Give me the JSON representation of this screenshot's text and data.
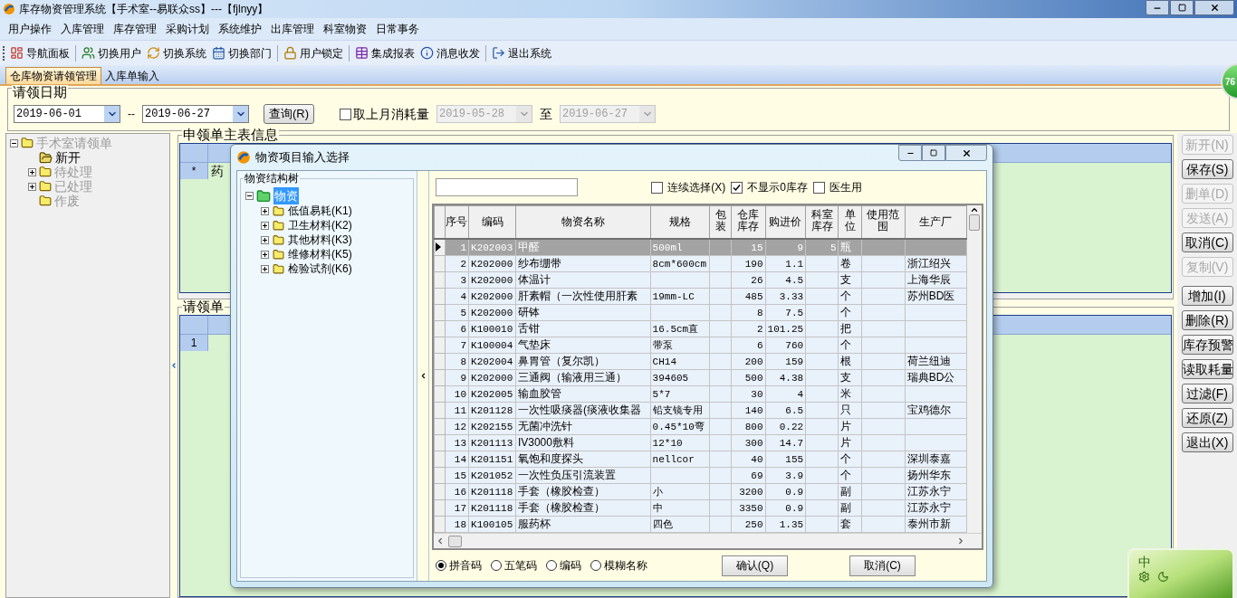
{
  "window": {
    "title": "库存物资管理系统【手术室--易联众ss】---【fjlnyy】"
  },
  "menu": [
    "用户操作",
    "入库管理",
    "库存管理",
    "采购计划",
    "系统维护",
    "出库管理",
    "科室物资",
    "日常事务"
  ],
  "toolbar": [
    {
      "label": "导航面板",
      "separator_after": true
    },
    {
      "label": "切换用户",
      "separator_after": false
    },
    {
      "label": "切换系统",
      "separator_after": false
    },
    {
      "label": "切换部门",
      "separator_after": true
    },
    {
      "label": "用户锁定",
      "separator_after": true
    },
    {
      "label": "集成报表",
      "separator_after": false
    },
    {
      "label": "消息收发",
      "separator_after": true
    },
    {
      "label": "退出系统",
      "separator_after": false
    }
  ],
  "tabs": [
    {
      "label": "仓库物资请领管理",
      "selected": true
    },
    {
      "label": "入库单输入",
      "selected": false
    }
  ],
  "date_group": {
    "title": "请领日期",
    "from": "2019-06-01",
    "dash": "--",
    "to": "2019-06-27",
    "query_button": "查询(R)",
    "last_month": {
      "label": "取上月消耗量",
      "checked": false
    },
    "range_from": "2019-05-28",
    "range_sep": "至",
    "range_to": "2019-06-27",
    "range_disabled": true
  },
  "tree": {
    "label": "手术室请领单",
    "expanded": true,
    "selected": false,
    "children": [
      {
        "label": "新开",
        "selected": true,
        "expandable": false
      },
      {
        "label": "待处理",
        "selected": false,
        "expandable": true
      },
      {
        "label": "已处理",
        "selected": false,
        "expandable": true
      },
      {
        "label": "作废",
        "selected": false,
        "expandable": false
      }
    ]
  },
  "master": {
    "title": "申领单主表信息",
    "rows": [
      {
        "marker": "*",
        "cell": "药"
      }
    ]
  },
  "detail": {
    "title": "请领单",
    "rows": [
      {
        "marker": "1"
      }
    ]
  },
  "side_buttons": [
    {
      "label": "新开(N)",
      "disabled": true
    },
    {
      "label": "保存(S)",
      "disabled": false
    },
    {
      "label": "删单(D)",
      "disabled": true
    },
    {
      "label": "发送(A)",
      "disabled": true
    },
    {
      "label": "取消(C)",
      "disabled": false
    },
    {
      "label": "复制(V)",
      "disabled": true
    },
    {
      "label": "增加(I)",
      "disabled": false
    },
    {
      "label": "删除(R)",
      "disabled": false
    },
    {
      "label": "库存预警",
      "disabled": false
    },
    {
      "label": "读取耗量",
      "disabled": false
    },
    {
      "label": "过滤(F)",
      "disabled": false
    },
    {
      "label": "还原(Z)",
      "disabled": false
    },
    {
      "label": "退出(X)",
      "disabled": false
    }
  ],
  "badge": "76",
  "ime": {
    "label": "中"
  },
  "dialog": {
    "title": "物资项目输入选择",
    "tree_title": "物资结构树",
    "tree": {
      "label": "物资",
      "expanded": true,
      "selected": true,
      "children": [
        {
          "label": "低值易耗(K1)",
          "expandable": true
        },
        {
          "label": "卫生材料(K2)",
          "expandable": true
        },
        {
          "label": "其他材料(K3)",
          "expandable": true
        },
        {
          "label": "维修材料(K5)",
          "expandable": true
        },
        {
          "label": "检验试剂(K6)",
          "expandable": true
        }
      ]
    },
    "options": [
      {
        "label": "连续选择(X)",
        "checked": false
      },
      {
        "label": "不显示0库存",
        "checked": true
      },
      {
        "label": "医生用",
        "checked": false
      }
    ],
    "columns": [
      "序号",
      "编码",
      "物资名称",
      "规格",
      "包装",
      "仓库库存",
      "购进价",
      "科室库存",
      "单位",
      "使用范围",
      "生产厂"
    ],
    "rows": [
      {
        "selected": true,
        "no": "1",
        "code": "K202003",
        "name": "甲醛",
        "spec": "500ml",
        "stock": "15",
        "price": "9",
        "dept_stock": "5",
        "unit": "瓶"
      },
      {
        "selected": false,
        "no": "2",
        "code": "K202000",
        "name": "纱布绷带",
        "spec": "8cm*600cm",
        "stock": "190",
        "price": "1.1",
        "unit": "卷",
        "maker": "浙江绍兴"
      },
      {
        "selected": false,
        "no": "3",
        "code": "K202000",
        "name": "体温计",
        "stock": "26",
        "price": "4.5",
        "unit": "支",
        "maker": "上海华辰"
      },
      {
        "selected": false,
        "no": "4",
        "code": "K202000",
        "name": "肝素帽（一次性使用肝素",
        "spec": "19mm-LC",
        "stock": "485",
        "price": "3.33",
        "unit": "个",
        "maker": "苏州BD医"
      },
      {
        "selected": false,
        "no": "5",
        "code": "K202000",
        "name": "研钵",
        "stock": "8",
        "price": "7.5",
        "unit": "个"
      },
      {
        "selected": false,
        "no": "6",
        "code": "K100010",
        "name": "舌钳",
        "spec": "16.5cm直",
        "stock": "2",
        "price": "101.25",
        "unit": "把"
      },
      {
        "selected": false,
        "no": "7",
        "code": "K100004",
        "name": "气垫床",
        "spec": "带泵",
        "stock": "6",
        "price": "760",
        "unit": "个"
      },
      {
        "selected": false,
        "no": "8",
        "code": "K202004",
        "name": "鼻胃管（复尔凯）",
        "spec": "CH14",
        "stock": "200",
        "price": "159",
        "unit": "根",
        "maker": "荷兰纽迪"
      },
      {
        "selected": false,
        "no": "9",
        "code": "K202000",
        "name": "三通阀（输液用三通）",
        "spec": "394605",
        "stock": "500",
        "price": "4.38",
        "unit": "支",
        "maker": "瑞典BD公"
      },
      {
        "selected": false,
        "no": "10",
        "code": "K202005",
        "name": "输血胶管",
        "spec": "5*7",
        "stock": "30",
        "price": "4",
        "unit": "米"
      },
      {
        "selected": false,
        "no": "11",
        "code": "K201128",
        "name": "一次性吸痰器(痰液收集器",
        "spec": "铅支镜专用",
        "stock": "140",
        "price": "6.5",
        "unit": "只",
        "maker": "宝鸡德尔"
      },
      {
        "selected": false,
        "no": "12",
        "code": "K202155",
        "name": "无菌冲洗针",
        "spec": "0.45*10弯",
        "stock": "800",
        "price": "0.22",
        "unit": "片"
      },
      {
        "selected": false,
        "no": "13",
        "code": "K201113",
        "name": "IV3000敷料",
        "spec": "12*10",
        "stock": "300",
        "price": "14.7",
        "unit": "片"
      },
      {
        "selected": false,
        "no": "14",
        "code": "K201151",
        "name": "氧饱和度探头",
        "spec": "nellcor",
        "stock": "40",
        "price": "155",
        "unit": "个",
        "maker": "深圳泰嘉"
      },
      {
        "selected": false,
        "no": "15",
        "code": "K201052",
        "name": "一次性负压引流装置",
        "stock": "69",
        "price": "3.9",
        "unit": "个",
        "maker": "扬州华东"
      },
      {
        "selected": false,
        "no": "16",
        "code": "K201118",
        "name": "手套（橡胶检查）",
        "spec": "小",
        "stock": "3200",
        "price": "0.9",
        "unit": "副",
        "maker": "江苏永宁"
      },
      {
        "selected": false,
        "no": "17",
        "code": "K201118",
        "name": "手套（橡胶检查）",
        "spec": "中",
        "stock": "3350",
        "price": "0.9",
        "unit": "副",
        "maker": "江苏永宁"
      },
      {
        "selected": false,
        "no": "18",
        "code": "K100105",
        "name": "服药杯",
        "spec": "四色",
        "stock": "250",
        "price": "1.35",
        "unit": "套",
        "maker": "泰州市新"
      }
    ],
    "search_modes": [
      {
        "label": "拼音码",
        "selected": true
      },
      {
        "label": "五笔码",
        "selected": false
      },
      {
        "label": "编码",
        "selected": false
      },
      {
        "label": "模糊名称",
        "selected": false
      }
    ],
    "buttons": [
      "确认(Q)",
      "取消(C)"
    ]
  }
}
